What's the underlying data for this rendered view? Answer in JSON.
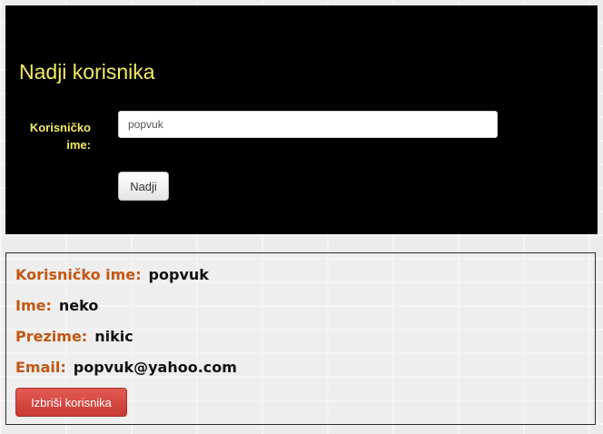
{
  "search": {
    "title": "Nadji korisnika",
    "username_label_line1": "Korisničko",
    "username_label_line2": "ime:",
    "username_value": "popvuk",
    "find_button": "Nadji"
  },
  "result": {
    "username_key": "Korisničko ime:",
    "username_value": "popvuk",
    "name_key": "Ime:",
    "name_value": "neko",
    "surname_key": "Prezime:",
    "surname_value": "nikic",
    "email_key": "Email:",
    "email_value": "popvuk@yahoo.com",
    "delete_button": "Izbriši korisnika"
  },
  "colors": {
    "panel_bg": "#000000",
    "label_yellow": "#f3ea62",
    "key_orange": "#c35612",
    "danger": "#d9534f"
  }
}
